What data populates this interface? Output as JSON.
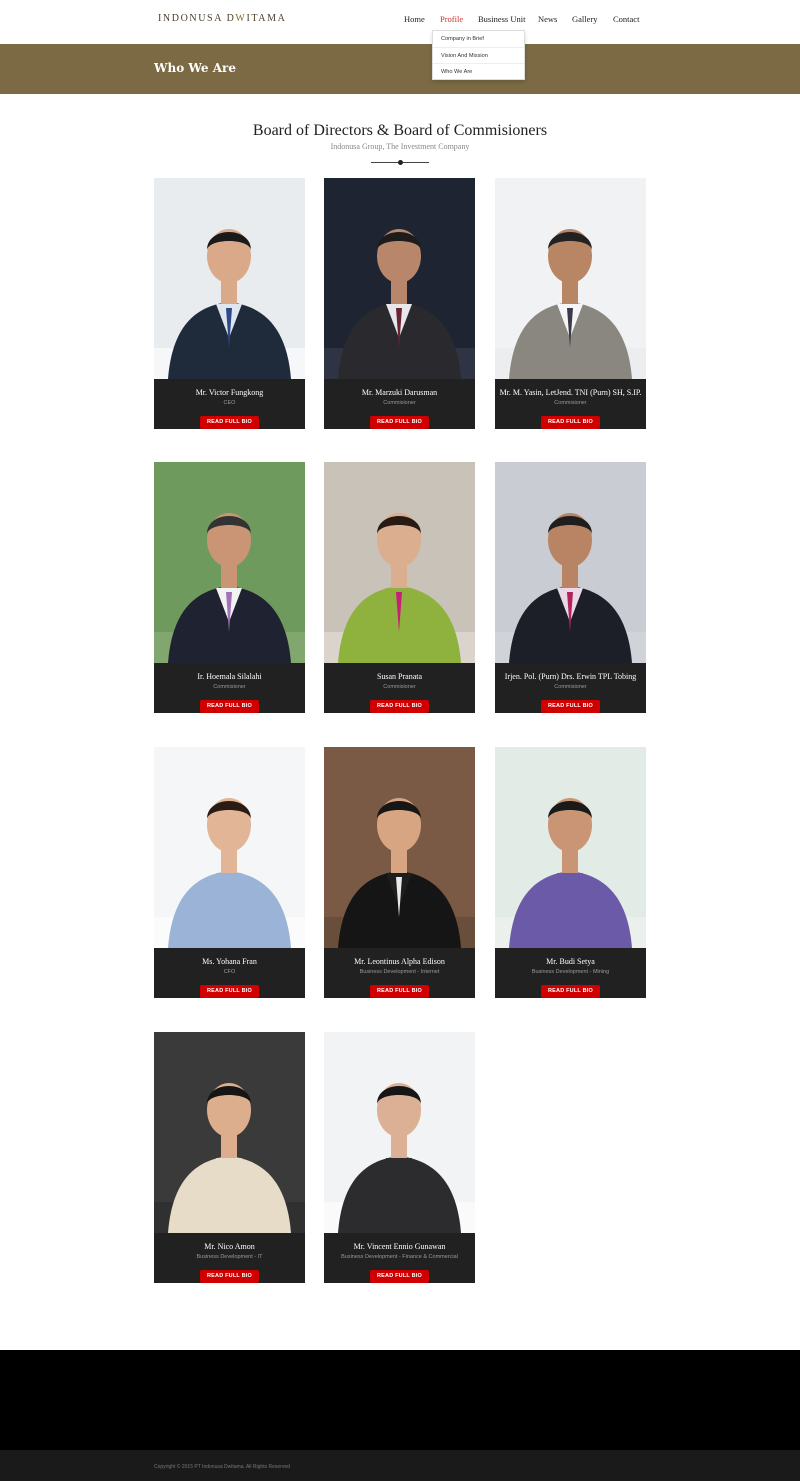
{
  "header": {
    "logo_left": "INDONUSA D",
    "logo_mark": "W",
    "logo_right": "ITAMA",
    "nav": [
      "Home",
      "Profile",
      "Business Unit",
      "News",
      "Gallery",
      "Contact"
    ],
    "active_nav": "Profile"
  },
  "dropdown": {
    "items": [
      "Company in Brief",
      "Vision And Mission",
      "Who We Are"
    ]
  },
  "page_title": "Who We Are",
  "section": {
    "title": "Board of Directors & Board of Commisioners",
    "subtitle": "Indonusa Group, The Investment Company"
  },
  "colors": {
    "band": "#7b6a44",
    "accent": "#d10000",
    "caption_bg": "#212121"
  },
  "cards": [
    {
      "name": "Mr. Victor Fungkong",
      "role": "CEO",
      "button": "READ FULL BIO"
    },
    {
      "name": "Mr. Marzuki Darusman",
      "role": "Commisioner",
      "button": "READ FULL BIO"
    },
    {
      "name": "Mr. M. Yasin, LetJend. TNI (Purn) SH, S.IP.",
      "role": "Commisioner",
      "button": "READ FULL BIO"
    },
    {
      "name": "Ir. Hoemala Silalahi",
      "role": "Commisioner",
      "button": "READ FULL BIO"
    },
    {
      "name": "Susan Pranata",
      "role": "Commisioner",
      "button": "READ FULL BIO"
    },
    {
      "name": "Irjen. Pol. (Purn) Drs. Erwin TPL Tobing",
      "role": "Commisioner",
      "button": "READ FULL BIO"
    },
    {
      "name": "Ms. Yohana Fran",
      "role": "CFO",
      "button": "READ FULL BIO"
    },
    {
      "name": "Mr. Leontinus Alpha Edison",
      "role": "Business Development - Internet",
      "button": "READ FULL BIO"
    },
    {
      "name": "Mr. Budi Setya",
      "role": "Business Development - Mining",
      "button": "READ FULL BIO"
    },
    {
      "name": "Mr. Nico Amon",
      "role": "Business Development - IT",
      "button": "READ FULL BIO"
    },
    {
      "name": "Mr. Vincent Ennio Gunawan",
      "role": "Business Development - Finance & Commercial",
      "button": "READ FULL BIO"
    }
  ],
  "footer": {
    "copyright": "Copyright © 2015 PT Indonusa Dwitama. All Rights Reserved"
  }
}
